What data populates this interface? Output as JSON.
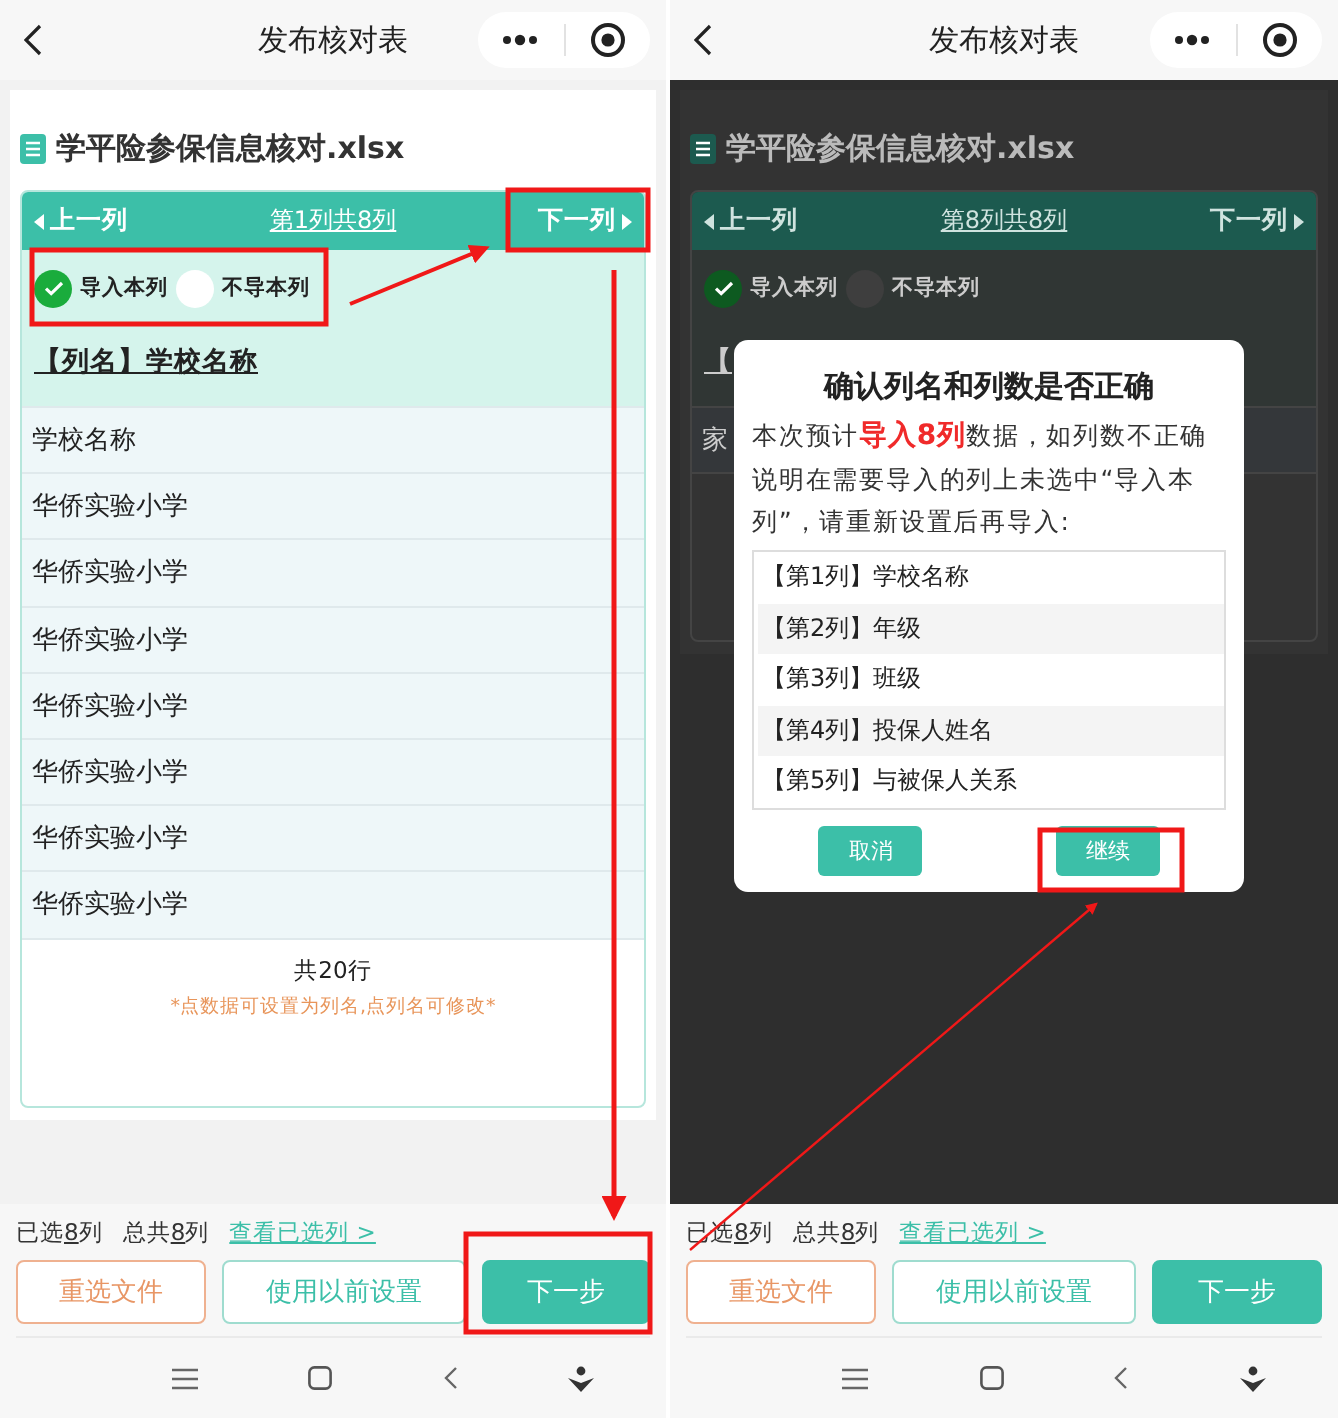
{
  "screens": [
    {
      "nav_title": "发布核对表",
      "file_name": "学平险参保信息核对.xlsx",
      "column_nav": {
        "prev": "上一列",
        "position": "第1列共8列",
        "next": "下一列"
      },
      "import_options": [
        {
          "label": "导入本列",
          "selected": true
        },
        {
          "label": "不导本列",
          "selected": false
        }
      ],
      "column_name": "【列名】学校名称",
      "rows": [
        "学校名称",
        "华侨实验小学",
        "华侨实验小学",
        "华侨实验小学",
        "华侨实验小学",
        "华侨实验小学",
        "华侨实验小学",
        "华侨实验小学"
      ],
      "total": "共20行",
      "hint": "*点数据可设置为列名,点列名可修改*",
      "footer": {
        "selected": {
          "prefix": "已选",
          "count": "8",
          "suffix": "列"
        },
        "all": {
          "prefix": "总共",
          "count": "8",
          "suffix": "列"
        },
        "link": "查看已选列 >"
      },
      "buttons": [
        {
          "label": "重选文件",
          "kind": "outline-orange"
        },
        {
          "label": "使用以前设置",
          "kind": "outline-teal"
        },
        {
          "label": "下一步",
          "kind": "primary"
        }
      ]
    },
    {
      "nav_title": "发布核对表",
      "file_name": "学平险参保信息核对.xlsx",
      "column_nav": {
        "prev": "上一列",
        "position": "第8列共8列",
        "next": "下一列"
      },
      "import_options": [
        {
          "label": "导入本列",
          "selected": true
        },
        {
          "label": "不导本列",
          "selected": false
        }
      ],
      "column_name": "【",
      "rows": [
        "家"
      ],
      "footer": {
        "selected": {
          "prefix": "已选",
          "count": "8",
          "suffix": "列"
        },
        "all": {
          "prefix": "总共",
          "count": "8",
          "suffix": "列"
        },
        "link": "查看已选列 >"
      },
      "buttons": [
        {
          "label": "重选文件",
          "kind": "outline-orange"
        },
        {
          "label": "使用以前设置",
          "kind": "outline-teal"
        },
        {
          "label": "下一步",
          "kind": "primary"
        }
      ],
      "dialog": {
        "title": "确认列名和列数是否正确",
        "message": "本次预计**导入8列**数据，如列数不正确说明在需要导入的列上未选中“导入本列”，请重新设置后再导入:",
        "items": [
          "【第1列】学校名称",
          "【第2列】年级",
          "【第3列】班级",
          "【第4列】投保人姓名",
          "【第5列】与被保人关系"
        ],
        "buttons": [
          {
            "label": "取消"
          },
          {
            "label": "继续"
          }
        ]
      }
    }
  ]
}
